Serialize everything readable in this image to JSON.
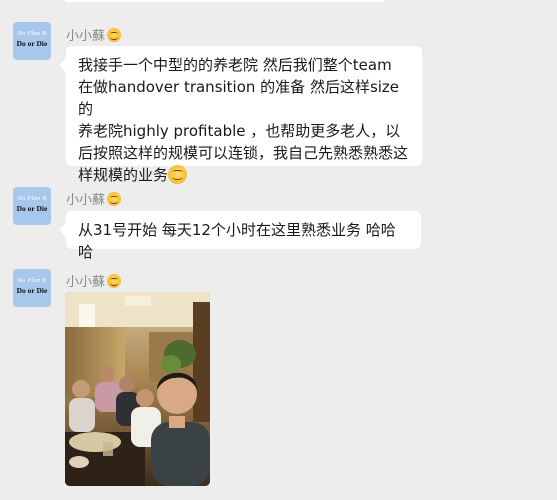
{
  "messages": [
    {
      "sender": "小小蘇",
      "sender_emoji": "smiling-face-icon",
      "type": "text",
      "lines": [
        "我接手一个中型的的养老院  然后我们整个team",
        "在做handover transition 的准备 然后这样size 的",
        "养老院highly profitable ，也帮助更多老人，以",
        "后按照这样的规模可以连锁，我自己先熟悉熟悉这",
        "样规模的业务"
      ],
      "trailing_emoji": "smiling-face-icon"
    },
    {
      "sender": "小小蘇",
      "sender_emoji": "smiling-face-icon",
      "type": "text",
      "lines": [
        "从31号开始 每天12个小时在这里熟悉业务 哈哈哈"
      ]
    },
    {
      "sender": "小小蘇",
      "sender_emoji": "smiling-face-icon",
      "type": "image",
      "image_desc": "group-selfie-photo"
    }
  ],
  "avatar": {
    "line1": "No Plan B",
    "line2": "Do or Die",
    "bg_color": "#a7c8ec"
  },
  "colors": {
    "background": "#ededed",
    "bubble": "#ffffff",
    "name": "#8a8a8a",
    "text": "#191919"
  }
}
